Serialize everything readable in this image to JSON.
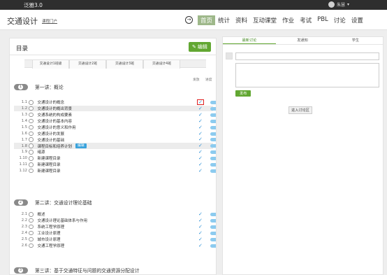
{
  "topbar": {
    "brand": "泛雅3.0",
    "user": "朱慧",
    "user_caret": "▾"
  },
  "header": {
    "title": "交通设计",
    "portal": "课程门户",
    "back_glyph": "→",
    "nav": [
      "首页",
      "统计",
      "资料",
      "互动课堂",
      "作业",
      "考试",
      "PBL",
      "讨论",
      "设置"
    ],
    "active_nav": "首页"
  },
  "catalog": {
    "title": "目录",
    "edit_label": "编辑",
    "edit_icon": "pencil-icon",
    "tabs": [
      "交通设计1班级",
      "交通设计2班",
      "交通设计3班",
      "交通设计4班"
    ],
    "col_publish": "发放",
    "col_progress": "进度",
    "check_glyph": "✓",
    "chapters": [
      {
        "num": "1",
        "title": "第一讲：概论",
        "lessons": [
          {
            "num": "1.1",
            "title": "交通设计的概念"
          },
          {
            "num": "1.2",
            "title": "交通设计的概出背景"
          },
          {
            "num": "1.3",
            "title": "交通系统的构成要素"
          },
          {
            "num": "1.4",
            "title": "交通设计的基本内容"
          },
          {
            "num": "1.5",
            "title": "交通设计的意义和作用"
          },
          {
            "num": "1.6",
            "title": "交通设计的发展"
          },
          {
            "num": "1.7",
            "title": "交通设计的基础"
          },
          {
            "num": "1.8",
            "title": "课程目标和培养计划",
            "badge": "编辑"
          },
          {
            "num": "1.9",
            "title": "绪源"
          },
          {
            "num": "1.10",
            "title": "新建课程目录"
          },
          {
            "num": "1.11",
            "title": "新建课程目录"
          },
          {
            "num": "1.12",
            "title": "新建课程目录"
          }
        ]
      },
      {
        "num": "2",
        "title": "第二讲：交通设计理论基础",
        "lessons": [
          {
            "num": "2.1",
            "title": "概述"
          },
          {
            "num": "2.2",
            "title": "交通设计理论基础体系与作用"
          },
          {
            "num": "2.3",
            "title": "系统工程学原理"
          },
          {
            "num": "2.4",
            "title": "工业设计原理"
          },
          {
            "num": "2.5",
            "title": "城市设计原理"
          },
          {
            "num": "2.6",
            "title": "交通工程学原理"
          }
        ]
      },
      {
        "num": "3",
        "title": "第三讲：基于交通特征与问题的交通资源分配设计",
        "lessons": []
      }
    ]
  },
  "discussion": {
    "tabs": [
      "最新讨论",
      "发通知",
      "学生"
    ],
    "active_tab": "最新讨论",
    "post_label": "发布",
    "enter_label": "进入讨论区"
  }
}
